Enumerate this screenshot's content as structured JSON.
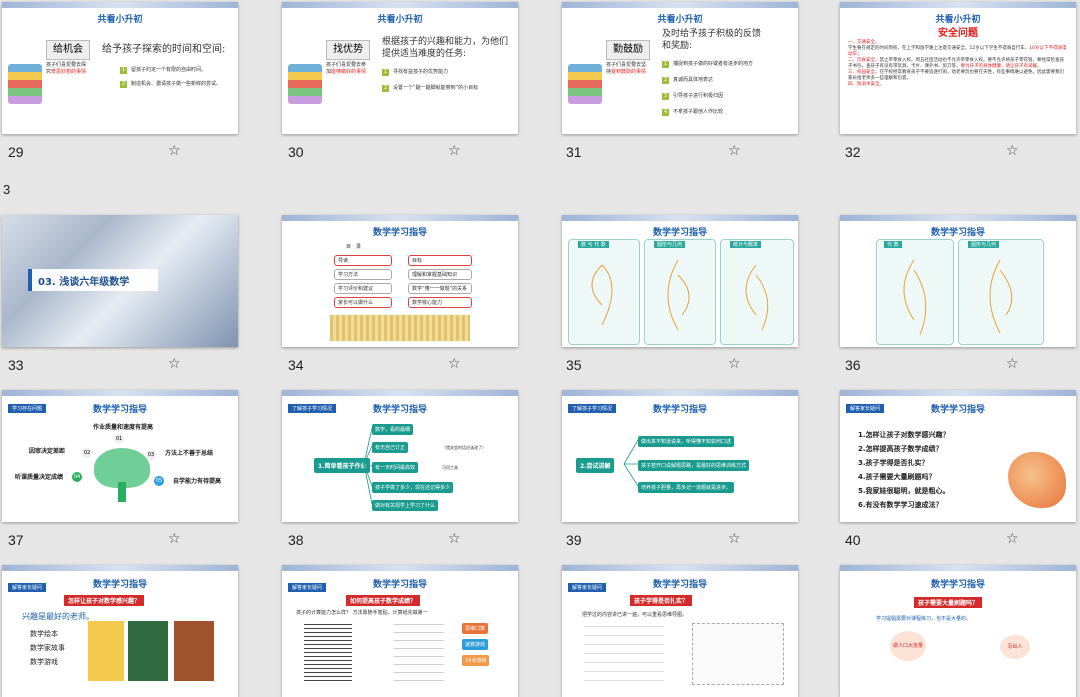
{
  "common_title": "共看小升初",
  "math_title": "数学学习指导",
  "section_label": "3",
  "section_title": "03. 浅谈六年级数学",
  "star_glyph": "☆",
  "slides": {
    "s29": {
      "number": "29",
      "badge": "给机会",
      "heading": "给予孩子探索的时间和空间:",
      "side_text_a": "孩子们喜爱要去探究",
      "side_text_b": "奇思妙想的事情",
      "items": [
        "留孩子约定一个有限的自由时间。",
        "制造机会、邀请孩子做一些新鲜的尝试。"
      ]
    },
    "s30": {
      "number": "30",
      "badge": "找优势",
      "heading": "根据孩子的兴趣和能力，为他们提供适当难度的任务:",
      "side_text_a": "孩子们喜爱要去参加",
      "side_text_b": "能够做好的事情",
      "items": [
        "寻找有益孩子的优势能力",
        "设置一个“踮一踮脚就能够到”的小目标"
      ]
    },
    "s31": {
      "number": "31",
      "badge": "勤鼓励",
      "heading": "及时给予孩子积极的反馈和奖励:",
      "side_text_a": "孩子们喜爱要去坚持",
      "side_text_b": "受到鼓励的事情",
      "items": [
        "捕捉到孩子做的好或者有进步的地方",
        "真诚而具体地表达",
        "引导孩子进行积极归因",
        "不拿孩子跟他人作比较"
      ]
    },
    "s32": {
      "number": "32",
      "heading": "安全问题",
      "p1_title": "一、交通安全。",
      "p1": "学生要在规定的时间到校，在上学和放学路上注意交通安全。12岁以下学生不得骑自行车，",
      "p1_red": "16岁以下不得骑电动车；",
      "p2_title": "二、饮食安全。",
      "p2": "禁止带零食入校。周五社团活动也不允许带零食入校。要不允许将孩子零花钱，要经常检查孩子书包，查孩子有没有带玩具、卡片、课外书、剪刀等，",
      "p2_red": "要为孩子的身体健康，请让孩子有早餐。",
      "p3_title": "三、校园安全。",
      "p3": "在学校经常教育孩子不要追逐打闹，劝老要玩也要在天性，有些事情难以避免，因此需要我们家长给老师多一些理解和包容。",
      "p4_title": "四、防溺水安全。"
    },
    "s33": {
      "number": "33"
    },
    "s34": {
      "number": "34",
      "menu_title": "目　录",
      "left_items": [
        "导读",
        "学习方法",
        "学习评价和建议",
        "家长可以做什么"
      ],
      "right_items": [
        "目标",
        "理解和掌握基础知识",
        "数学“懂一一做题”的关系",
        "数学核心能力"
      ]
    },
    "s35": {
      "number": "35",
      "panels": [
        "数 与 代 数",
        "图形与几何",
        "统计与概率"
      ]
    },
    "s36": {
      "number": "36",
      "panels": [
        "代 数",
        "图形与几何"
      ]
    },
    "s37": {
      "number": "37",
      "tag": "学习存在问题",
      "labels": [
        "作业质量和速度有提高",
        "因审决定差距",
        "方法上不善于总结",
        "听课质量决定成绩",
        "自学能力有待提高"
      ],
      "nums": [
        "01",
        "02",
        "03",
        "04",
        "05"
      ]
    },
    "s38": {
      "number": "38",
      "tag": "了解孩子学习情况",
      "center": "1.简单看孩子作业",
      "branches": [
        "数学，看的最细",
        "有无自己订正",
        "有一天时间最高效",
        "孩子学做了多少，现在还记得多少",
        "做对有关现学上学习了什么"
      ],
      "notes": [
        "（错关会的话应该改了）",
        "可用工具"
      ]
    },
    "s39": {
      "number": "39",
      "tag": "了解孩子学习情况",
      "center": "2.尝试讲解",
      "branches": [
        "做出来不知道说来，听得懂不知如何口述",
        "孩子若开口说解题思路，是最好的思维训练方式",
        "培养孩子胆量，再多记一道题就是进步。"
      ]
    },
    "s40": {
      "number": "40",
      "tag": "解答家长疑问",
      "questions": [
        "1.怎样让孩子对数学感兴趣？",
        "2.怎样提高孩子数学成绩？",
        "3.孩子学得是否扎实？",
        "4.孩子需要大量刷题吗？",
        "5.我家娃很聪明，就是粗心。",
        "6.有没有数学学习速成法？"
      ]
    },
    "s41": {
      "tag": "解答家长疑问",
      "banner": "怎样让孩子对数学感兴趣？",
      "lead": "兴趣是最好的老师。",
      "list": [
        "数学绘本",
        "数学家故事",
        "数学游戏"
      ]
    },
    "s42": {
      "tag": "解答家长疑问",
      "banner": "如何提高孩子数学成绩？",
      "lead": "孩子的计算能力怎么样？ 方法靠随手笔贴，计算纸先做第一",
      "chips": [
        "思维口算",
        "速算游戏",
        "24点游戏"
      ]
    },
    "s43": {
      "tag": "解答家长疑问",
      "banner": "孩子学得是否扎实？",
      "lead": "把学过的内容讲已讲一遍，可以重看思维导图。"
    },
    "s44": {
      "banner": "孩子需要大量刷题吗？",
      "lead": "学习提倡需要对课程练习，也不是大量的。",
      "bubble_a": "做人口大批量",
      "bubble_b": "写出人"
    }
  }
}
